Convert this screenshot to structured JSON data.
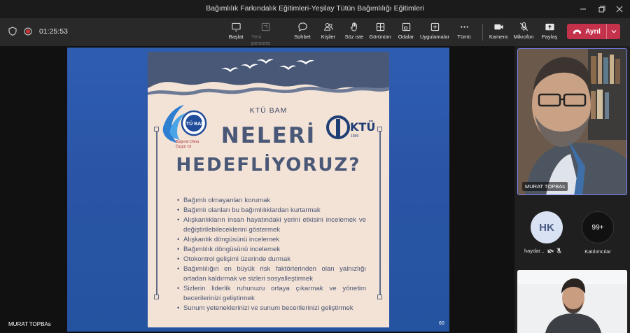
{
  "window": {
    "title": "Bağımlılık Farkındalık Eğitimleri-Yeşilay Tütün Bağımlılığı Eğitimleri",
    "controls": [
      "minimize-icon",
      "maximize-icon",
      "close-icon"
    ]
  },
  "toolbar": {
    "timer": "01:25:53",
    "items": [
      {
        "icon": "start-icon",
        "label": "Başlat",
        "enabled": true
      },
      {
        "icon": "new-window-icon",
        "label": "Yeni pencere",
        "enabled": false
      },
      {
        "icon": "chat-icon",
        "label": "Sohbet",
        "enabled": true
      },
      {
        "icon": "people-icon",
        "label": "Kişiler",
        "enabled": true
      },
      {
        "icon": "raise-hand-icon",
        "label": "Söz iste",
        "enabled": true
      },
      {
        "icon": "view-icon",
        "label": "Görünüm",
        "enabled": true
      },
      {
        "icon": "rooms-icon",
        "label": "Odalar",
        "enabled": true
      },
      {
        "icon": "apps-icon",
        "label": "Uygulamalar",
        "enabled": true
      },
      {
        "icon": "more-icon",
        "label": "Tümü",
        "enabled": true
      },
      {
        "icon": "camera-icon",
        "label": "Kamera",
        "enabled": true
      },
      {
        "icon": "mic-off-icon",
        "label": "Mikrofon",
        "enabled": true
      },
      {
        "icon": "share-icon",
        "label": "Paylaş",
        "enabled": true
      }
    ],
    "leave_label": "Ayrıl",
    "leave_color": "#c4314b"
  },
  "slide": {
    "org": "KTÜ BAM",
    "left_logo_text": "KTÜ BAM",
    "left_logo_caption_1": "Bağımlı Olma",
    "left_logo_caption_2": "Özgür Ol",
    "right_logo_text": "KTÜ",
    "right_logo_year": "1955",
    "headline_1": "NELERİ",
    "headline_2": "HEDEFLİYORUZ?",
    "bullets": [
      "Bağımlı olmayanları korumak",
      "Bağımlı olanları bu bağımlılıklardan kurtarmak",
      "Alışkanlıkların insan hayatındaki yerini etkisini incelemek ve değiştirilebileceklerini göstermek",
      "Alışkanlık döngüsünü incelemek",
      "Bağımlılık döngüsünü incelemek",
      "Otokontrol gelişimi üzerinde durmak",
      "Bağımlılığın en büyük risk faktörlerinden olan yalnızlığı ortadan kaldırmak ve sizleri sosyalleştirmek",
      "Sizlerin liderlik ruhunuzu ortaya çıkarmak ve yönetim becerilerinizi geliştirmek",
      "Sunum yeteneklerinizi ve sunum becerilerinizi geliştirmek"
    ],
    "page_number": "60",
    "presenter": "MURAT TOPBAs",
    "colors": {
      "background": "#f3e2d6",
      "accent": "#4a5877",
      "share_bg": "#2a54a6"
    }
  },
  "participants": {
    "main_video_name": "MURAT TOPBAs",
    "avatar_initials": "HK",
    "avatar_name": "haydar...",
    "count": "99+",
    "count_label": "Katılımcılar",
    "active_border": "#7f85f5"
  }
}
